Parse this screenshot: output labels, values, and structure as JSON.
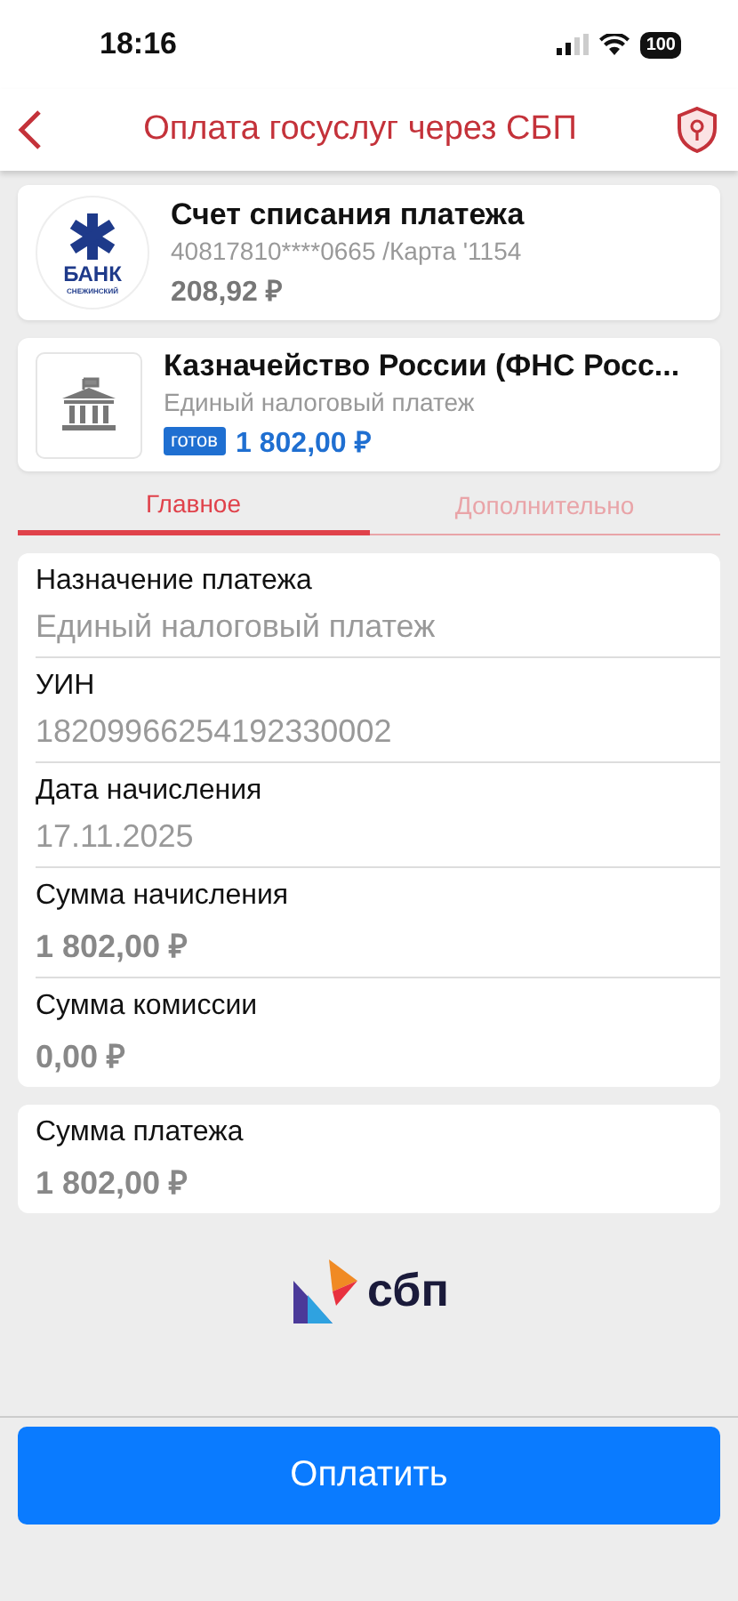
{
  "status_bar": {
    "time": "18:16",
    "battery": "100"
  },
  "header": {
    "title": "Оплата госуслуг через СБП"
  },
  "cards": [
    {
      "kind": "bank",
      "logo_text": "БАНК",
      "logo_subtext": "СНЕЖИНСКИЙ",
      "title": "Счет списания платежа",
      "subtitle": "40817810****0665 /Карта '1154",
      "amount": "208,92 ₽"
    },
    {
      "kind": "payee",
      "title": "Казначейство России (ФНС Росс...",
      "subtitle": "Единый налоговый платеж",
      "badge": "готов",
      "amount": "1 802,00 ₽"
    }
  ],
  "tabs": [
    {
      "label": "Главное",
      "selected": true
    },
    {
      "label": "Дополнительно",
      "selected": false
    }
  ],
  "fields": [
    {
      "label": "Назначение платежа",
      "value": "Единый налоговый платеж",
      "kind": "text"
    },
    {
      "label": "УИН",
      "value": "18209966254192330002",
      "kind": "text"
    },
    {
      "label": "Дата начисления",
      "value": "17.11.2025",
      "kind": "text"
    },
    {
      "label": "Сумма начисления",
      "value": "1 802,00 ₽",
      "kind": "amount"
    },
    {
      "label": "Сумма комиссии",
      "value": "0,00 ₽",
      "kind": "amount"
    }
  ],
  "total": {
    "label": "Сумма платежа",
    "value": "1 802,00 ₽"
  },
  "logo": {
    "text": "сбп"
  },
  "pay_button": {
    "label": "Оплатить"
  }
}
